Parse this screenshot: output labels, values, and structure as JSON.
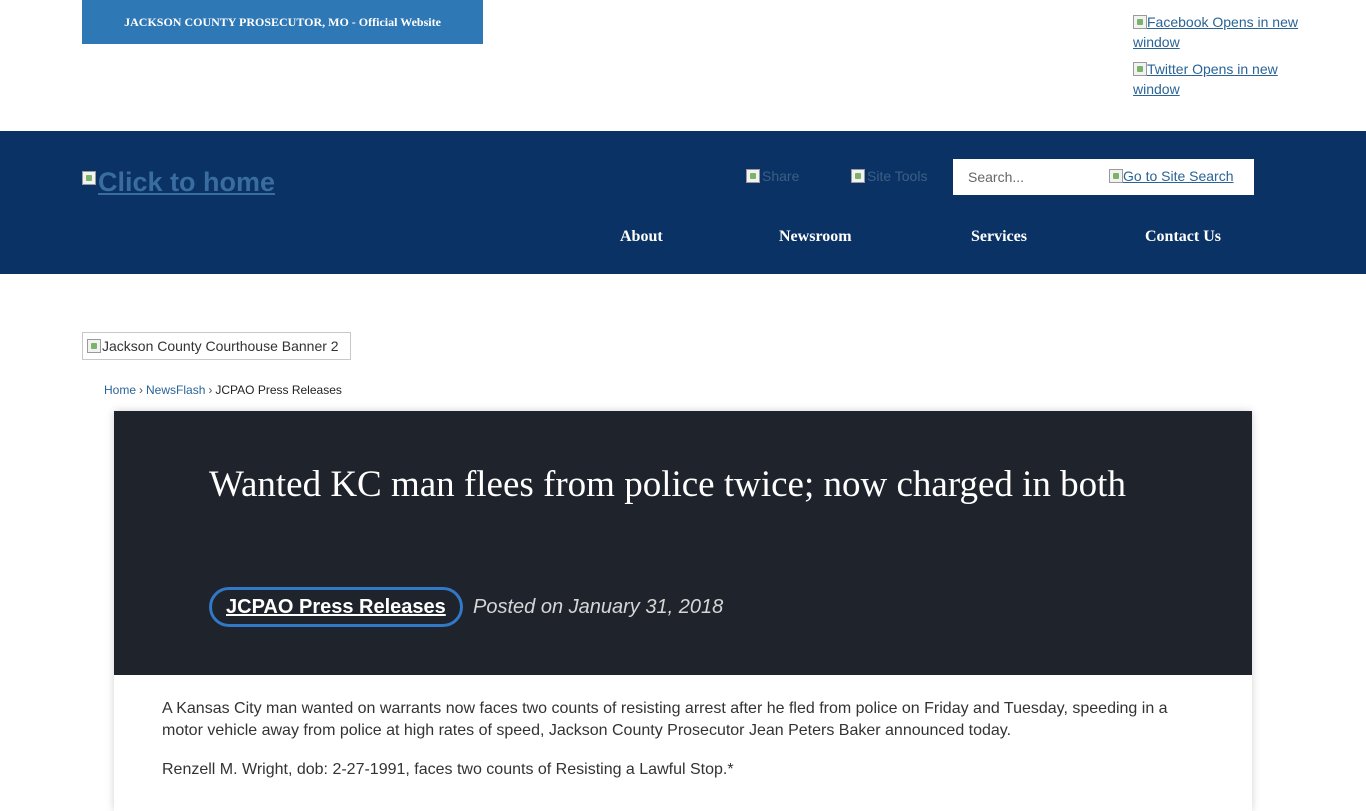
{
  "top_bar": {
    "official_text": "JACKSON COUNTY PROSECUTOR, MO - Official Website"
  },
  "social": {
    "facebook": "Facebook Opens in new window",
    "twitter": "Twitter Opens in new window"
  },
  "header": {
    "home_link": "Click to home",
    "share": "Share",
    "site_tools": "Site Tools",
    "search_placeholder": "Search...",
    "search_go": "Go to Site Search",
    "nav": [
      "About",
      "Newsroom",
      "Services",
      "Contact Us"
    ]
  },
  "banner": {
    "alt": "Jackson County Courthouse Banner 2"
  },
  "breadcrumb": [
    "Home",
    "NewsFlash",
    "JCPAO Press Releases"
  ],
  "article": {
    "title": "Wanted KC man flees from police twice; now charged in both",
    "category": "JCPAO Press Releases",
    "posted": "Posted on January 31, 2018",
    "paragraphs": [
      "A Kansas City man wanted on warrants now faces two counts of resisting arrest after he fled from police on Friday and Tuesday, speeding in a motor vehicle away from police at high rates of speed, Jackson County Prosecutor Jean Peters Baker announced today.",
      "Renzell M. Wright, dob: 2-27-1991, faces two counts of Resisting a Lawful Stop.*"
    ]
  },
  "colors": {
    "official_bar": "#2f78b6",
    "header_bg": "#0b3264",
    "article_head_bg": "#1f232b",
    "pill_border": "#3178c6",
    "link": "#2a6496"
  }
}
